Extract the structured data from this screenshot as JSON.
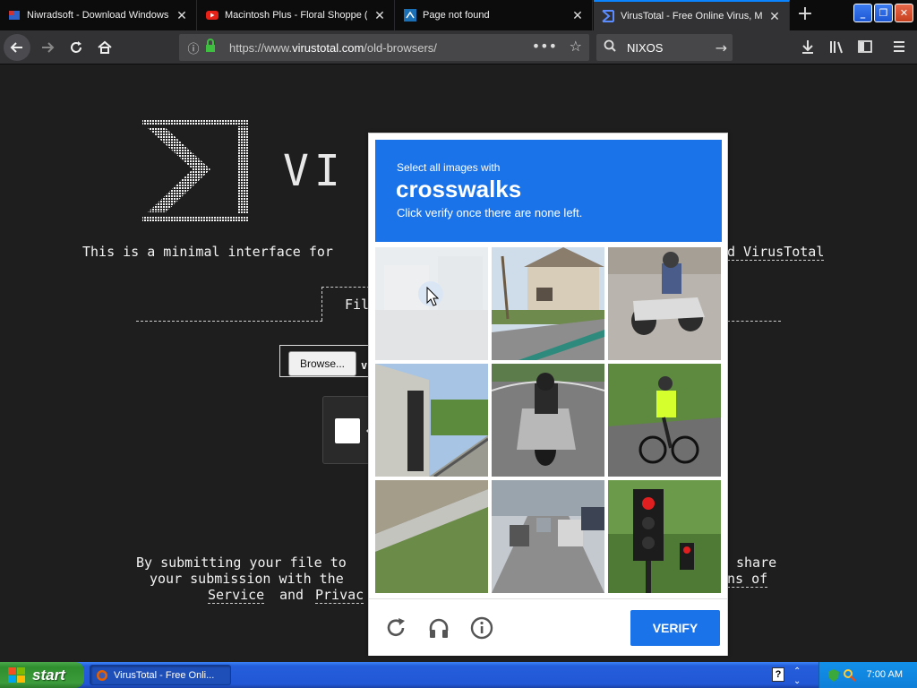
{
  "browser": {
    "tabs": [
      {
        "title": "Niwradsoft - Download Windows",
        "icon": "flag-icon"
      },
      {
        "title": "Macintosh Plus - Floral Shoppe (F",
        "icon": "youtube-icon"
      },
      {
        "title": "Page not found",
        "icon": "page-icon"
      },
      {
        "title": "VirusTotal - Free Online Virus, Ma",
        "icon": "virustotal-icon"
      }
    ],
    "url_prefix": "https://www.",
    "url_domain": "virustotal.com",
    "url_path": "/old-browsers/",
    "search_value": "NIXOS"
  },
  "page": {
    "ascii_word": "VI",
    "intro_left": "This is a minimal interface for",
    "intro_right": "d VirusTotal",
    "file_label": "Fil",
    "browse_label": "Browse...",
    "browse_suffix": "v",
    "footer_line1_left": "By submitting your file to",
    "footer_line1_right": "share",
    "footer_line2_left": "your submission with the",
    "footer_line2_right": "ns of",
    "footer_line3_a": "Service",
    "footer_line3_b": "and",
    "footer_line3_c": "Privac"
  },
  "captcha": {
    "instruction_small": "Select all images with",
    "target": "crosswalks",
    "instruction_sub": "Click verify once there are none left.",
    "verify_label": "VERIFY",
    "tiles": [
      "faded-street",
      "house-street",
      "motorcycle-rider",
      "building-stairs",
      "scooter-rider",
      "cyclist",
      "guardrail",
      "traffic-cars",
      "traffic-light"
    ]
  },
  "taskbar": {
    "start_label": "start",
    "task_label": "VirusTotal - Free Onli...",
    "clock": "7:00 AM"
  }
}
